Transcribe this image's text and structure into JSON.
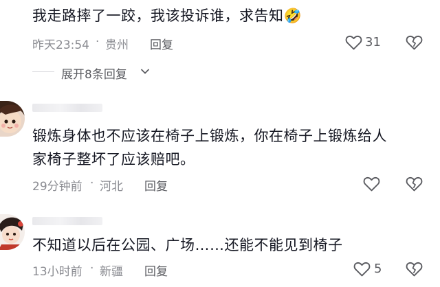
{
  "comments": [
    {
      "text": "我走路摔了一跤，我该投诉谁，求告知🤣",
      "time": "昨天23:54",
      "sep": "·",
      "location": "贵州",
      "reply_label": "回复",
      "like_count": "31",
      "expand_label": "展开8条回复"
    },
    {
      "text_line1": "锻炼身体也不应该在椅子上锻炼，你在椅子上锻炼给人",
      "text_line2": "家椅子整坏了应该赔吧。",
      "time": "29分钟前",
      "sep": "·",
      "location": "河北",
      "reply_label": "回复"
    },
    {
      "text": "不知道以后在公园、广场……还能不能见到椅子",
      "time": "13小时前",
      "sep": "·",
      "location": "新疆",
      "reply_label": "回复",
      "like_count": "5"
    }
  ],
  "icons": {
    "like": "heart-outline-icon",
    "dislike": "broken-heart-icon",
    "expand": "chevron-down-icon"
  },
  "colors": {
    "text": "#161823",
    "meta": "#8a8b91",
    "icon": "#5a5b60"
  }
}
